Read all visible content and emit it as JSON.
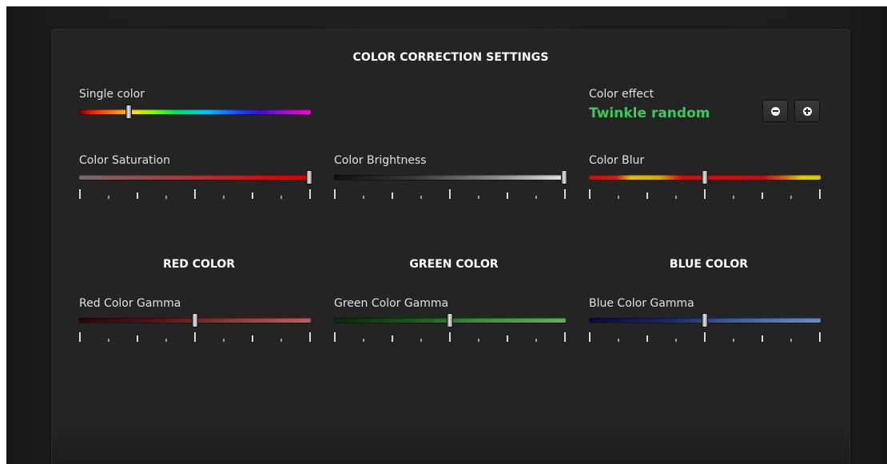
{
  "header": {
    "title": "COLOR CORRECTION SETTINGS"
  },
  "single_color": {
    "label": "Single color",
    "value": 0.21
  },
  "color_effect": {
    "label": "Color effect",
    "value": "Twinkle random",
    "value_color": "#3fc65c",
    "decrease_icon": "minus-circle-icon",
    "increase_icon": "plus-circle-icon"
  },
  "saturation": {
    "label": "Color Saturation",
    "value": 1.0
  },
  "brightness": {
    "label": "Color Brightness",
    "value": 1.0
  },
  "blur": {
    "label": "Color Blur",
    "value": 0.5
  },
  "sections": {
    "red": {
      "title": "RED COLOR",
      "gamma_label": "Red Color Gamma",
      "value": 0.5
    },
    "green": {
      "title": "GREEN COLOR",
      "gamma_label": "Green Color Gamma",
      "value": 0.5
    },
    "blue": {
      "title": "BLUE COLOR",
      "gamma_label": "Blue Color Gamma",
      "value": 0.5
    }
  },
  "colors": {
    "accent_green": "#3fc65c",
    "panel": "#242424",
    "text": "#e0e0e0"
  }
}
